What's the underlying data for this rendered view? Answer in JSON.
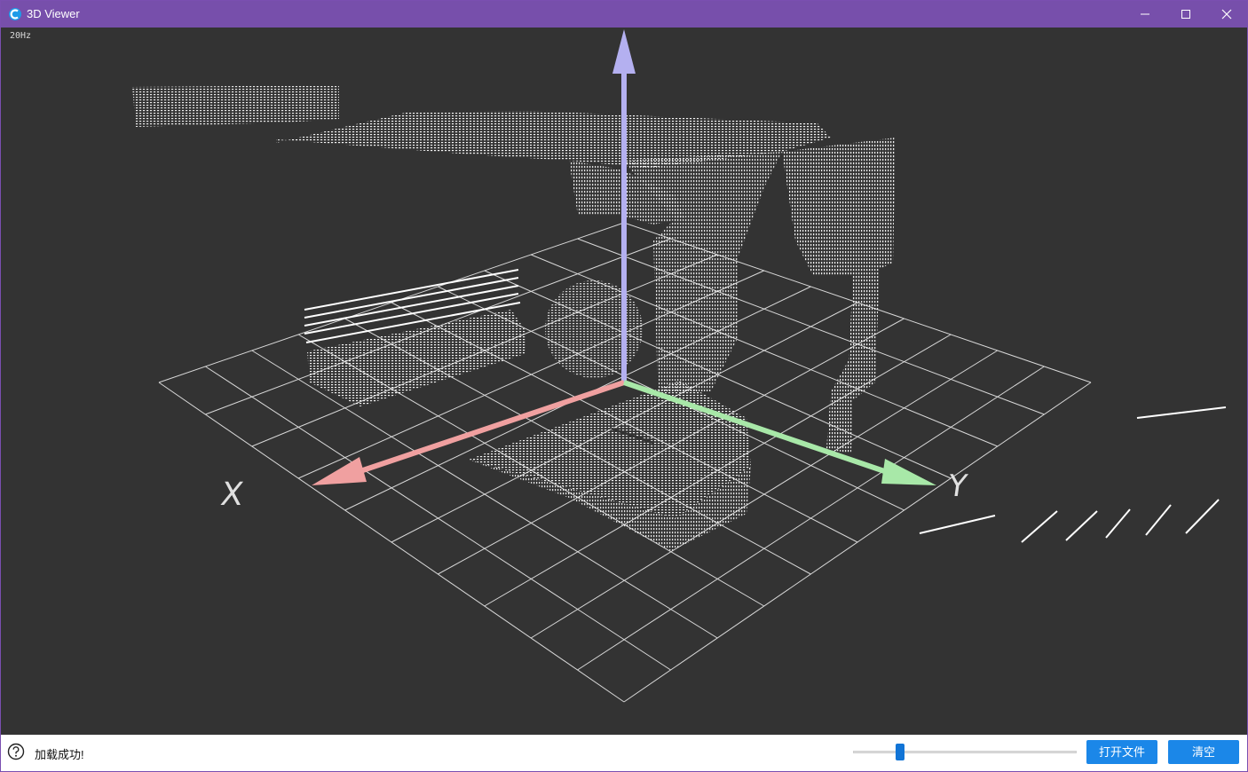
{
  "window": {
    "title": "3D Viewer",
    "accent_color": "#774fab",
    "app_icon": "app-logo-icon",
    "controls": {
      "minimize": "minimize-icon",
      "maximize": "maximize-icon",
      "close": "close-icon"
    }
  },
  "viewport": {
    "fps_label": "20Hz",
    "background": "#333333",
    "axes": {
      "x": {
        "label": "X",
        "color": "#f0a0a0"
      },
      "y": {
        "label": "Y",
        "color": "#a8e8a8"
      },
      "z": {
        "color": "#b4b0f0"
      }
    },
    "grid": {
      "cells": 10,
      "color": "#d8d8d8"
    }
  },
  "statusbar": {
    "help_icon": "help-icon",
    "message": "加载成功!",
    "slider_value": 0.2,
    "open_button": "打开文件",
    "clear_button": "清空"
  }
}
